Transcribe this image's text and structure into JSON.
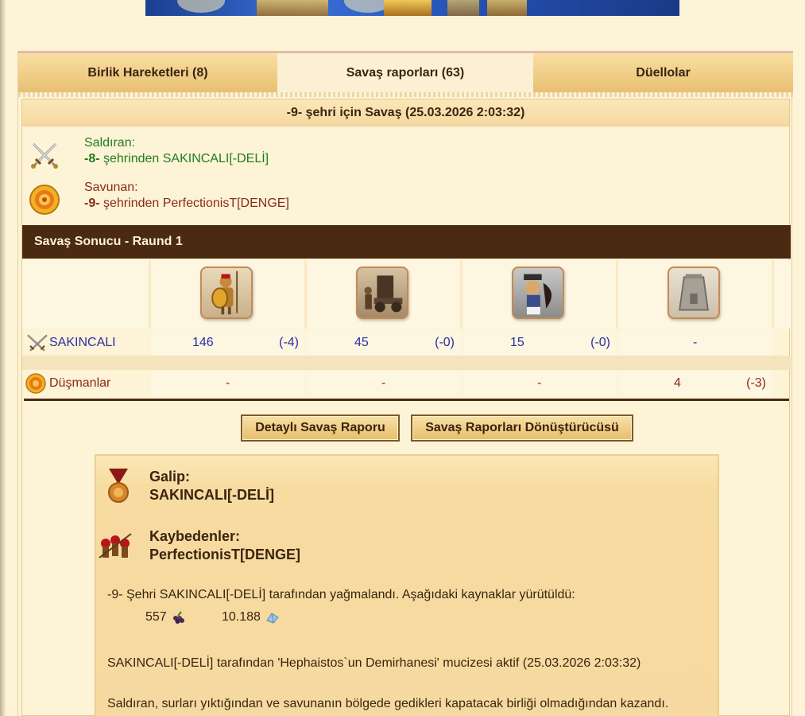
{
  "tabs": [
    {
      "label": "Birlik Hareketleri (8)"
    },
    {
      "label": "Savaş raporları (63)"
    },
    {
      "label": "Düellolar"
    }
  ],
  "report": {
    "title": "-9- şehri için Savaş (25.03.2026 2:03:32)",
    "attacker": {
      "role": "Saldıran:",
      "city": "-8-",
      "from_text": " şehrinden SAKINCALI[-DELİ]"
    },
    "defender": {
      "role": "Savunan:",
      "city": "-9-",
      "from_text": " şehrinden PerfectionisT[DENGE]"
    },
    "round_title": "Savaş Sonucu - Raund 1",
    "units": [
      "spearman-unit",
      "catapult-unit",
      "archer-unit",
      "wall-tower-unit"
    ],
    "rows": [
      {
        "name": "SAKINCALI",
        "cells": [
          {
            "v": "146",
            "d": "(-4)"
          },
          {
            "v": "45",
            "d": "(-0)"
          },
          {
            "v": "15",
            "d": "(-0)"
          },
          {
            "v": "-",
            "d": ""
          }
        ]
      },
      {
        "name": "Düşmanlar",
        "cells": [
          {
            "v": "-",
            "d": ""
          },
          {
            "v": "-",
            "d": ""
          },
          {
            "v": "-",
            "d": ""
          },
          {
            "v": "4",
            "d": "(-3)"
          }
        ]
      }
    ],
    "buttons": {
      "detail": "Detaylı Savaş Raporu",
      "converter": "Savaş Raporları Dönüştürücüsü"
    },
    "summary": {
      "winner_label": "Galip:",
      "winner_name": "SAKINCALI[-DELİ]",
      "loser_label": "Kaybedenler:",
      "loser_name": "PerfectionisT[DENGE]",
      "plunder_text": "-9- Şehri SAKINCALI[-DELİ] tarafından yağmalandı. Aşağıdaki kaynaklar yürütüldü:",
      "resources": [
        {
          "amount": "557",
          "icon": "grapes-icon"
        },
        {
          "amount": "10.188",
          "icon": "marble-icon"
        }
      ],
      "wonder_text": "SAKINCALI[-DELİ] tarafından 'Hephaistos`un Demirhanesi' mucizesi aktif (25.03.2026 2:03:32)",
      "reason_text": "Saldıran, surları yıktığından ve savunanın bölgede gedikleri kapatacak birliği olmadığından kazandı."
    }
  },
  "colors": {
    "accent_dark": "#4b2a12",
    "attacker_green": "#1f7d1f",
    "defender_maroon": "#8a2a1a",
    "unit_blue": "#2c2ca8"
  }
}
